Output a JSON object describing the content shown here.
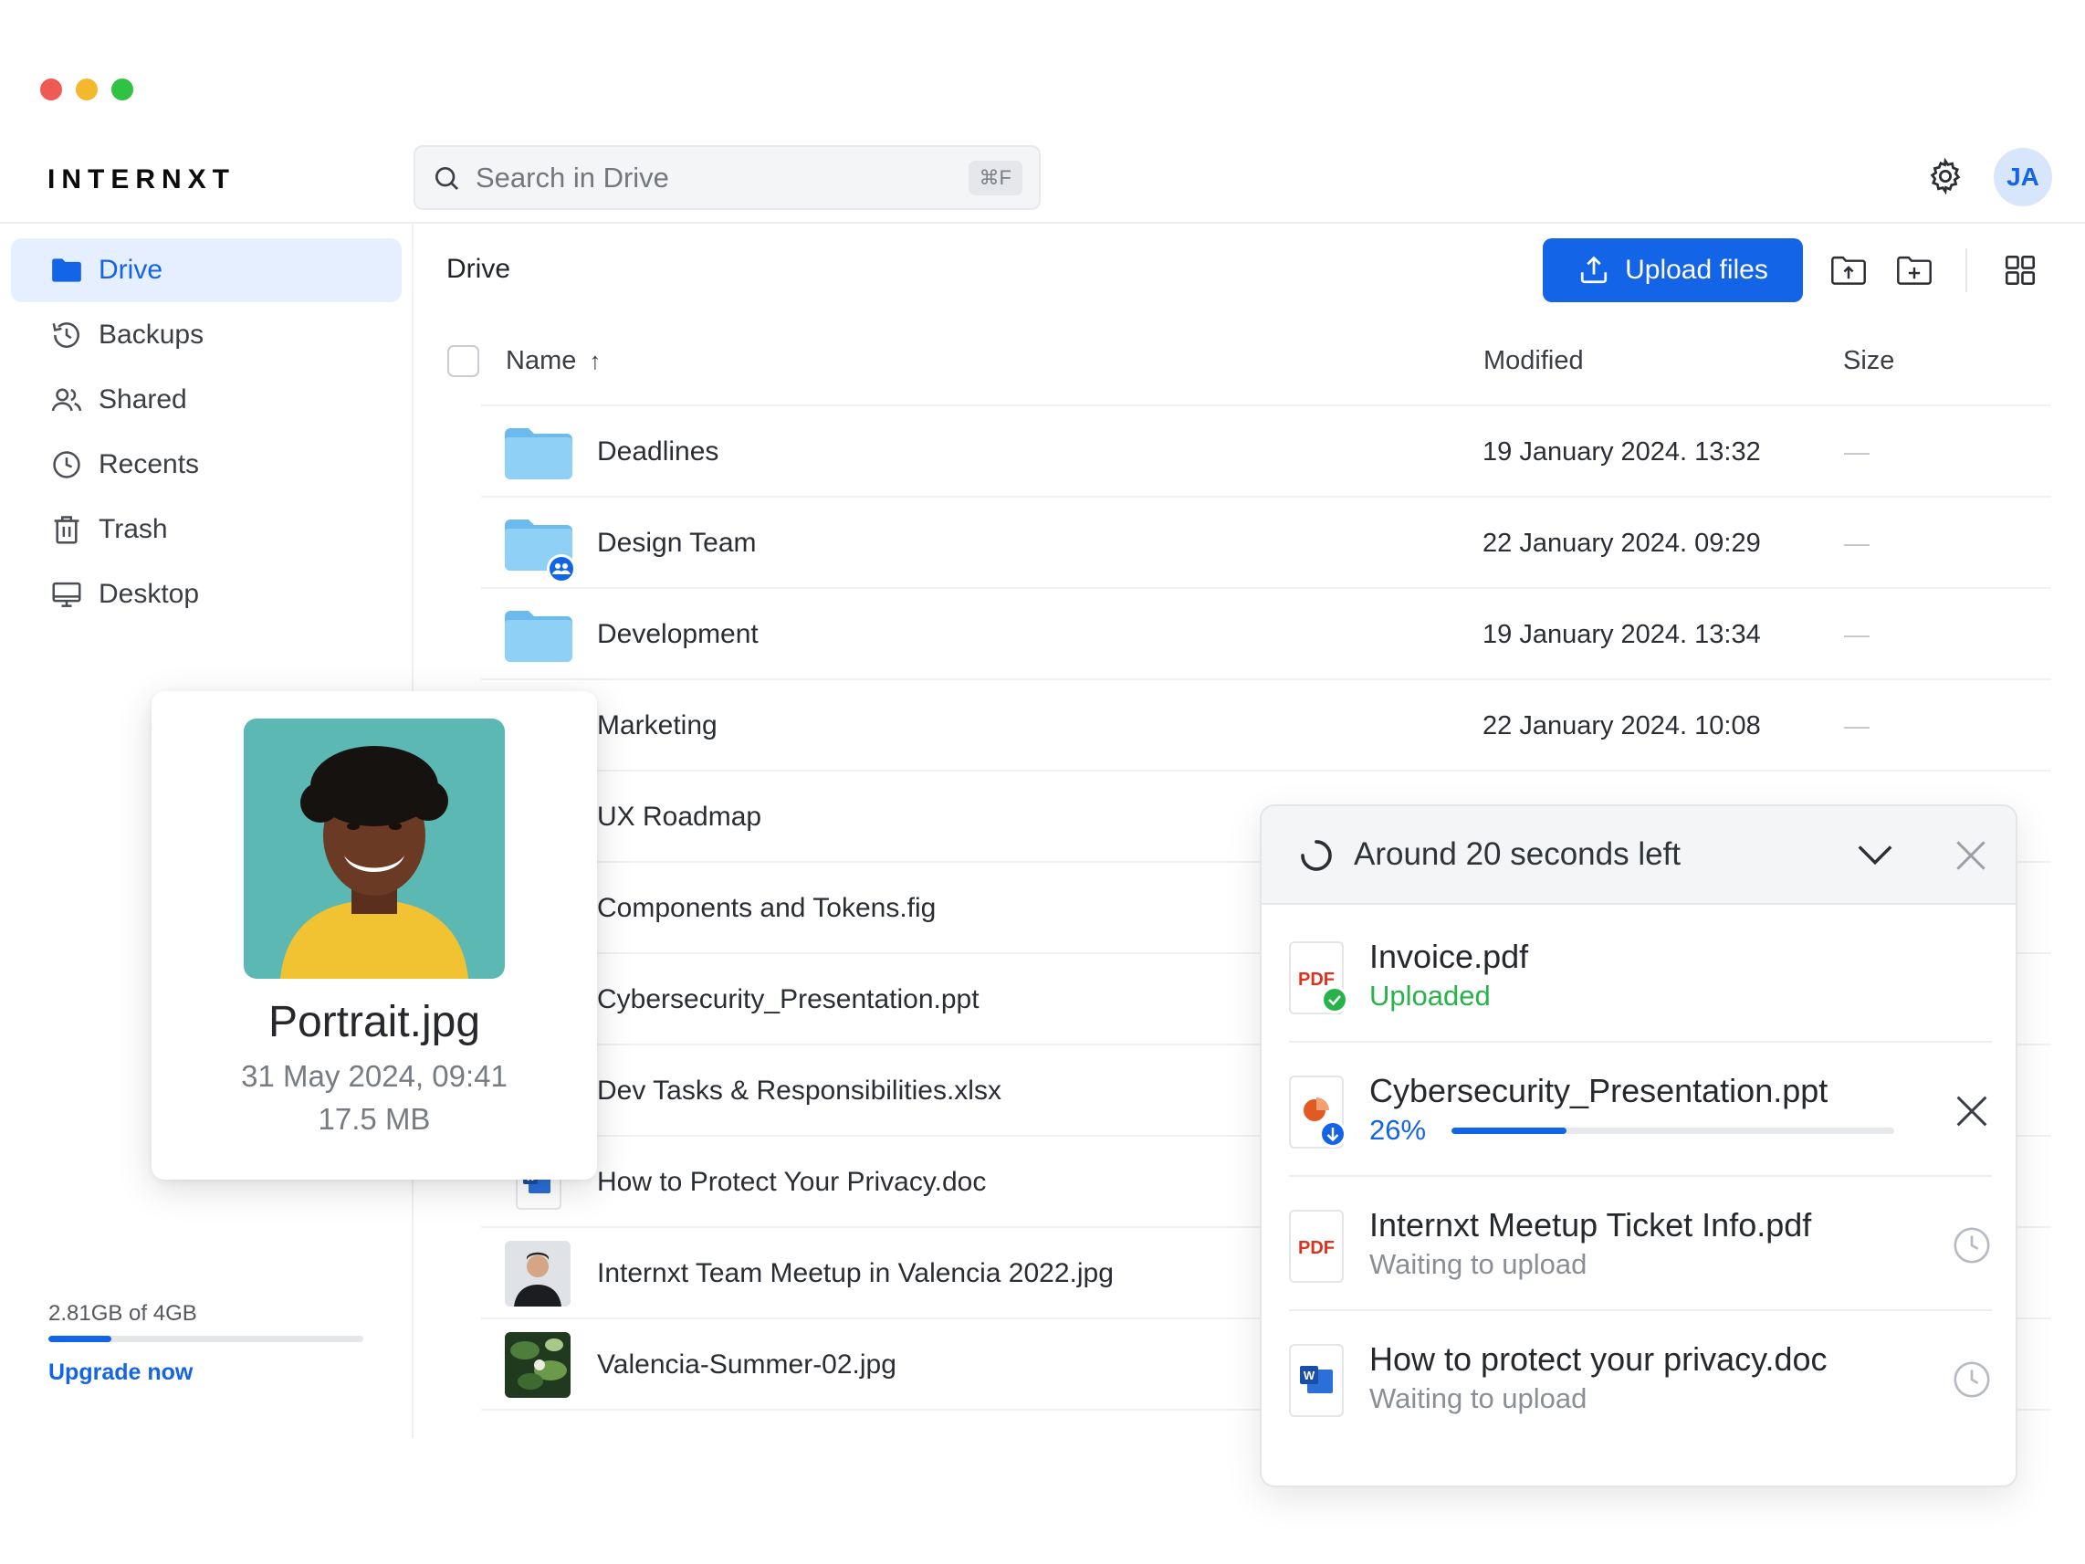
{
  "app": {
    "logo": "INTERNXT",
    "avatar_initials": "JA"
  },
  "search": {
    "placeholder": "Search in Drive",
    "shortcut": "⌘F"
  },
  "sidebar": {
    "items": [
      {
        "label": "Drive",
        "icon": "folder-icon",
        "active": true
      },
      {
        "label": "Backups",
        "icon": "history-icon"
      },
      {
        "label": "Shared",
        "icon": "users-icon"
      },
      {
        "label": "Recents",
        "icon": "clock-icon"
      },
      {
        "label": "Trash",
        "icon": "trash-icon"
      },
      {
        "label": "Desktop",
        "icon": "monitor-icon"
      }
    ],
    "storage": {
      "label": "2.81GB of 4GB",
      "used_fraction": 0.2,
      "upgrade": "Upgrade now"
    }
  },
  "main": {
    "breadcrumb": "Drive",
    "upload_button": "Upload files",
    "columns": {
      "name": "Name",
      "sort_arrow": "↑",
      "modified": "Modified",
      "size": "Size"
    },
    "files": [
      {
        "name": "Deadlines",
        "modified": "19 January 2024. 13:32",
        "size": "—",
        "type": "folder"
      },
      {
        "name": "Design Team",
        "modified": "22 January 2024. 09:29",
        "size": "—",
        "type": "shared-folder"
      },
      {
        "name": "Development",
        "modified": "19 January 2024. 13:34",
        "size": "—",
        "type": "folder"
      },
      {
        "name": "Marketing",
        "modified": "22 January 2024. 10:08",
        "size": "—",
        "type": "folder"
      },
      {
        "name": "UX Roadmap",
        "type": "file"
      },
      {
        "name": "Components and Tokens.fig",
        "type": "file"
      },
      {
        "name": "Cybersecurity_Presentation.ppt",
        "type": "file"
      },
      {
        "name": "Dev Tasks & Responsibilities.xlsx",
        "type": "file"
      },
      {
        "name": "How to Protect Your Privacy.doc",
        "type": "doc"
      },
      {
        "name": "Internxt Team Meetup in Valencia 2022.jpg",
        "type": "image-person"
      },
      {
        "name": "Valencia-Summer-02.jpg",
        "type": "image-plant"
      }
    ]
  },
  "preview": {
    "title": "Portrait.jpg",
    "date": "31 May 2024, 09:41",
    "size": "17.5 MB"
  },
  "upload_panel": {
    "title": "Around 20 seconds left",
    "items": [
      {
        "name": "Invoice.pdf",
        "status": "Uploaded",
        "kind": "pdf"
      },
      {
        "name": "Cybersecurity_Presentation.ppt",
        "status": "26%",
        "progress": 0.26,
        "kind": "ppt"
      },
      {
        "name": "Internxt Meetup Ticket Info.pdf",
        "status": "Waiting to upload",
        "kind": "pdf"
      },
      {
        "name": "How to protect your privacy.doc",
        "status": "Waiting to upload",
        "kind": "doc"
      }
    ]
  },
  "colors": {
    "accent": "#1464e8",
    "success": "#27b34a",
    "folder": "#7cc4f2"
  }
}
